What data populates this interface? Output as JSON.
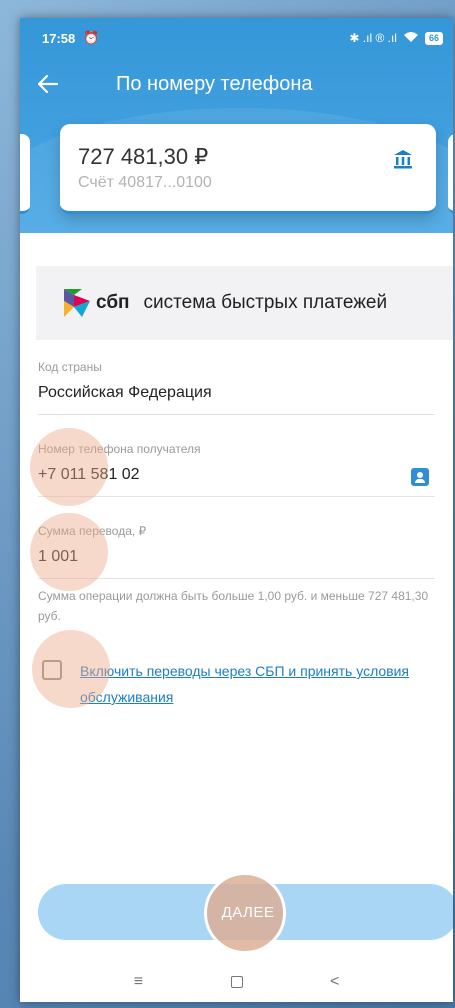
{
  "status_bar": {
    "time": "17:58",
    "icons_text": "✱ .ıl ® .ıl",
    "battery": "66"
  },
  "header": {
    "title": "По номеру телефона"
  },
  "account_card": {
    "amount": "727 481,30 ₽",
    "account": "Счёт 40817...0100"
  },
  "sbp_banner": {
    "logo_word": "сбп",
    "text": "система быстрых платежей"
  },
  "form": {
    "country": {
      "label": "Код страны",
      "value": "Российская Федерация"
    },
    "phone": {
      "label": "Номер телефона получателя",
      "value": "+7 011 581 02"
    },
    "amount": {
      "label": "Сумма перевода, ₽",
      "value": "1 001"
    },
    "hint": "Сумма операции должна быть больше 1,00 руб. и меньше 727 481,30 руб.",
    "checkbox_label": "Включить переводы через СБП и принять условия обслуживания",
    "checkbox_checked": false
  },
  "next_button": {
    "label": "ДАЛЕЕ"
  },
  "navbar": {
    "menu_glyph": "≡",
    "back_glyph": "<"
  },
  "colors": {
    "primary": "#3597d8",
    "button_disabled": "#a9d6f4",
    "link": "#1b7fc7"
  }
}
